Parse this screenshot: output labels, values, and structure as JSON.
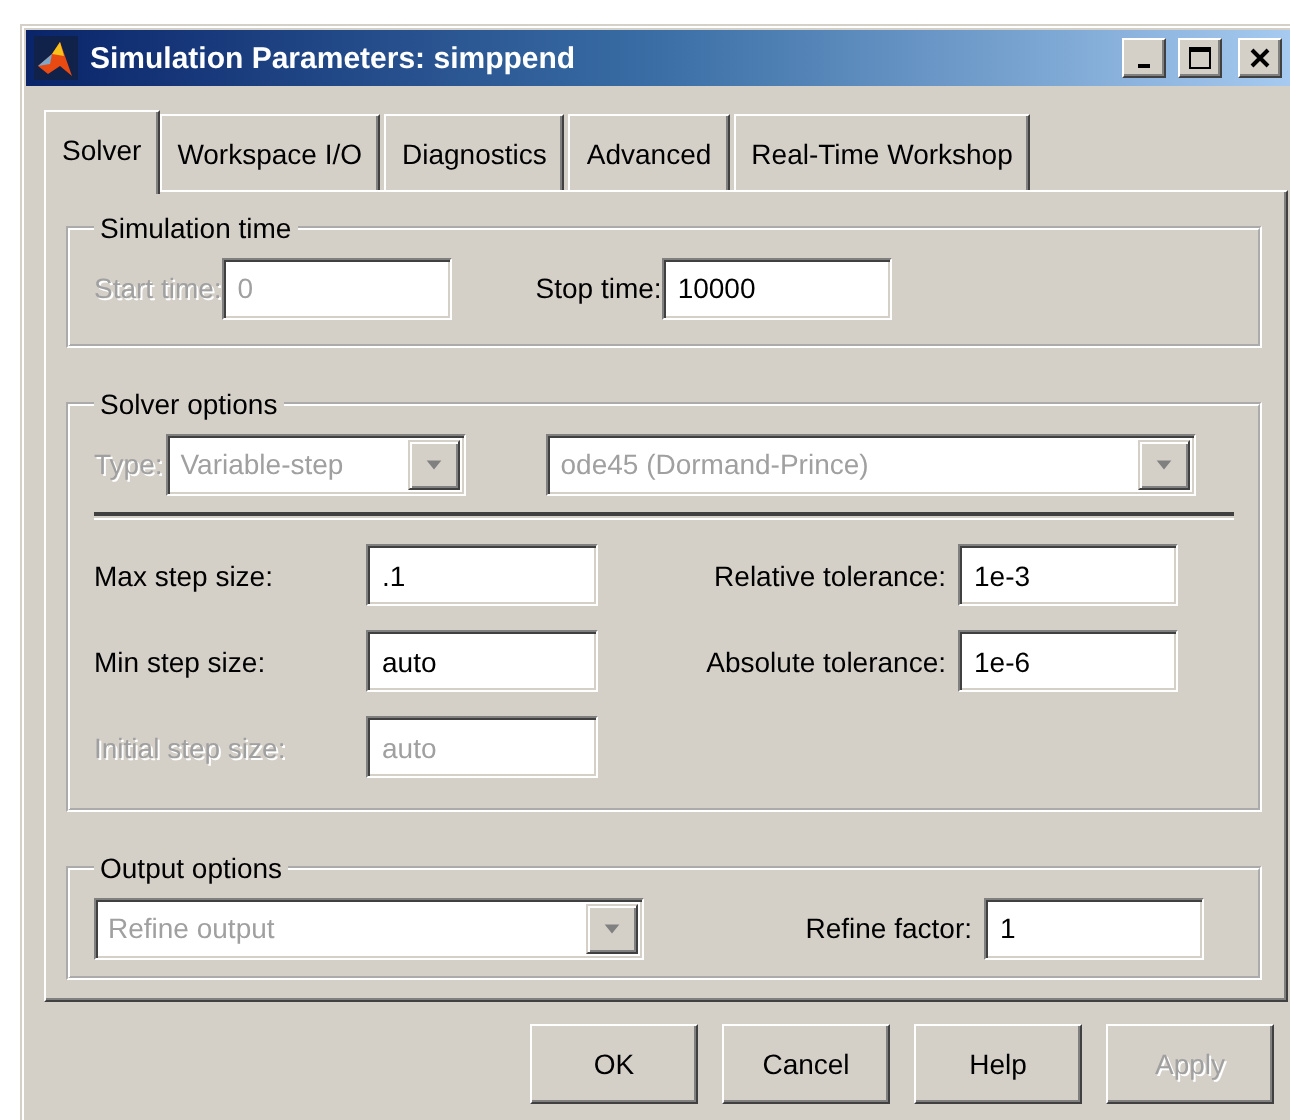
{
  "window": {
    "title": "Simulation Parameters: simppend"
  },
  "tabs": [
    {
      "label": "Solver",
      "selected": true
    },
    {
      "label": "Workspace I/O",
      "selected": false
    },
    {
      "label": "Diagnostics",
      "selected": false
    },
    {
      "label": "Advanced",
      "selected": false
    },
    {
      "label": "Real-Time Workshop",
      "selected": false
    }
  ],
  "simulation_time": {
    "title": "Simulation time",
    "fields": [
      {
        "label": "Start time:",
        "value": "0",
        "disabled": true
      },
      {
        "label": "Stop time:",
        "value": "10000",
        "disabled": false
      }
    ]
  },
  "solver_options": {
    "title": "Solver options",
    "type": {
      "label": "Type:",
      "value": "Variable-step",
      "disabled": true
    },
    "solver": {
      "value": "ode45 (Dormand-Prince)",
      "disabled": true
    },
    "rows": [
      {
        "left": {
          "label": "Max step size:",
          "value": ".1",
          "disabled": false
        },
        "right": {
          "label": "Relative tolerance:",
          "value": "1e-3",
          "disabled": false
        }
      },
      {
        "left": {
          "label": "Min step size:",
          "value": "auto",
          "disabled": false
        },
        "right": {
          "label": "Absolute tolerance:",
          "value": "1e-6",
          "disabled": false
        }
      },
      {
        "left": {
          "label": "Initial step size:",
          "value": "auto",
          "disabled": true
        }
      }
    ]
  },
  "output_options": {
    "title": "Output options",
    "dropdown": {
      "value": "Refine output",
      "disabled": true
    },
    "field": {
      "label": "Refine factor:",
      "value": "1",
      "disabled": false
    }
  },
  "buttons": [
    {
      "label": "OK",
      "disabled": false
    },
    {
      "label": "Cancel",
      "disabled": false
    },
    {
      "label": "Help",
      "disabled": false
    },
    {
      "label": "Apply",
      "disabled": true
    }
  ]
}
